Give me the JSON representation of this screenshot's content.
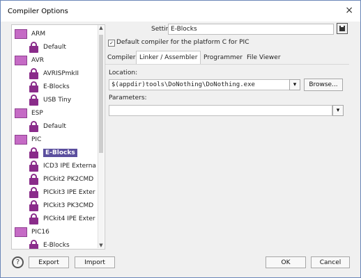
{
  "window": {
    "title": "Compiler Options",
    "close": "×"
  },
  "tree": [
    {
      "label": "ARM",
      "icon": "folder-icon"
    },
    {
      "label": "Default",
      "icon": "lock-icon"
    },
    {
      "label": "AVR",
      "icon": "folder-icon"
    },
    {
      "label": "AVRISPmkII",
      "icon": "lock-icon"
    },
    {
      "label": "E-Blocks",
      "icon": "lock-icon"
    },
    {
      "label": "USB Tiny",
      "icon": "lock-icon"
    },
    {
      "label": "ESP",
      "icon": "folder-icon"
    },
    {
      "label": "Default",
      "icon": "lock-icon"
    },
    {
      "label": "PIC",
      "icon": "folder-icon"
    },
    {
      "label": "E-Blocks",
      "icon": "lock-icon",
      "selected": true
    },
    {
      "label": "ICD3 IPE Externa",
      "icon": "lock-icon"
    },
    {
      "label": "PICkit2 PK2CMD",
      "icon": "lock-icon"
    },
    {
      "label": "PICkit3 IPE Exter",
      "icon": "lock-icon"
    },
    {
      "label": "PICkit3 PK3CMD",
      "icon": "lock-icon"
    },
    {
      "label": "PICkit4 IPE Exter",
      "icon": "lock-icon"
    },
    {
      "label": "PIC16",
      "icon": "folder-icon"
    },
    {
      "label": "E-Blocks",
      "icon": "lock-icon"
    }
  ],
  "settings": {
    "setting_name_label": "Setting name:",
    "setting_name_value": "E-Blocks",
    "default_checkbox_label": "Default compiler for the platform C for PIC",
    "default_checked": true
  },
  "tabs": [
    "Compiler",
    "Linker / Assembler",
    "Programmer",
    "File Viewer"
  ],
  "active_tab": "Linker / Assembler",
  "location": {
    "label": "Location:",
    "value": "$(appdir)tools\\DoNothing\\DoNothing.exe",
    "browse": "Browse..."
  },
  "parameters": {
    "label": "Parameters:",
    "value": ""
  },
  "footer": {
    "help": "?",
    "export": "Export",
    "import": "Import",
    "ok": "OK",
    "cancel": "Cancel"
  },
  "colors": {
    "folder": "#c56bc5",
    "lock": "#8a2c8a",
    "selection": "#5b4f9e"
  }
}
